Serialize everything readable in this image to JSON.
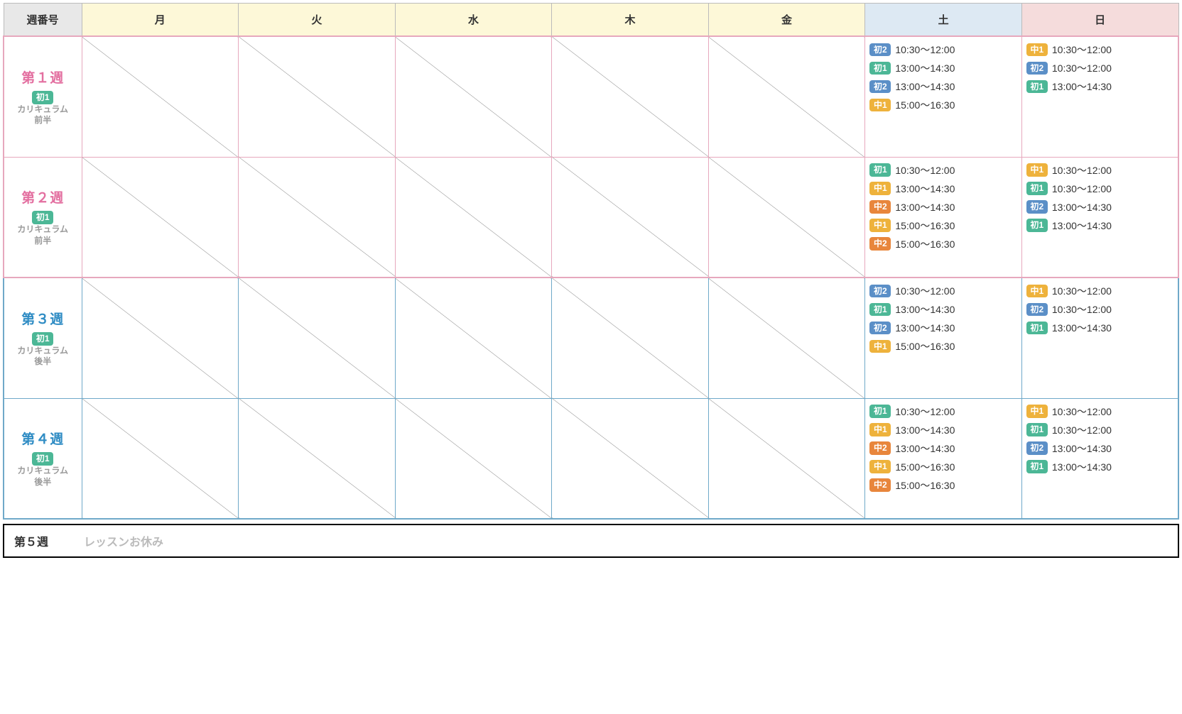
{
  "header": {
    "week_no": "週番号",
    "days": [
      "月",
      "火",
      "水",
      "木",
      "金",
      "土",
      "日"
    ]
  },
  "tags": {
    "s1": "初1",
    "s2": "初2",
    "m1": "中1",
    "m2": "中2"
  },
  "weeks": [
    {
      "id": "w1",
      "group": "pink",
      "title": "第１週",
      "badge": "s1",
      "sub1": "カリキュラム",
      "sub2": "前半",
      "sat": [
        {
          "tag": "s2",
          "time": "10:30～12:00"
        },
        {
          "tag": "s1",
          "time": "13:00～14:30"
        },
        {
          "tag": "s2",
          "time": "13:00～14:30"
        },
        {
          "tag": "m1",
          "time": "15:00～16:30"
        }
      ],
      "sun": [
        {
          "tag": "m1",
          "time": "10:30～12:00"
        },
        {
          "tag": "s2",
          "time": "10:30～12:00"
        },
        {
          "tag": "s1",
          "time": "13:00～14:30"
        }
      ]
    },
    {
      "id": "w2",
      "group": "pink",
      "title": "第２週",
      "badge": "s1",
      "sub1": "カリキュラム",
      "sub2": "前半",
      "sat": [
        {
          "tag": "s1",
          "time": "10:30～12:00"
        },
        {
          "tag": "m1",
          "time": "13:00～14:30"
        },
        {
          "tag": "m2",
          "time": "13:00～14:30"
        },
        {
          "tag": "m1",
          "time": "15:00～16:30"
        },
        {
          "tag": "m2",
          "time": "15:00～16:30"
        }
      ],
      "sun": [
        {
          "tag": "m1",
          "time": "10:30～12:00"
        },
        {
          "tag": "s1",
          "time": "10:30～12:00"
        },
        {
          "tag": "s2",
          "time": "13:00～14:30"
        },
        {
          "tag": "s1",
          "time": "13:00～14:30"
        }
      ]
    },
    {
      "id": "w3",
      "group": "blue",
      "title": "第３週",
      "badge": "s1",
      "sub1": "カリキュラム",
      "sub2": "後半",
      "sat": [
        {
          "tag": "s2",
          "time": "10:30～12:00"
        },
        {
          "tag": "s1",
          "time": "13:00～14:30"
        },
        {
          "tag": "s2",
          "time": "13:00～14:30"
        },
        {
          "tag": "m1",
          "time": "15:00～16:30"
        }
      ],
      "sun": [
        {
          "tag": "m1",
          "time": "10:30～12:00"
        },
        {
          "tag": "s2",
          "time": "10:30～12:00"
        },
        {
          "tag": "s1",
          "time": "13:00～14:30"
        }
      ]
    },
    {
      "id": "w4",
      "group": "blue",
      "title": "第４週",
      "badge": "s1",
      "sub1": "カリキュラム",
      "sub2": "後半",
      "sat": [
        {
          "tag": "s1",
          "time": "10:30～12:00"
        },
        {
          "tag": "m1",
          "time": "13:00～14:30"
        },
        {
          "tag": "m2",
          "time": "13:00～14:30"
        },
        {
          "tag": "m1",
          "time": "15:00～16:30"
        },
        {
          "tag": "m2",
          "time": "15:00～16:30"
        }
      ],
      "sun": [
        {
          "tag": "m1",
          "time": "10:30～12:00"
        },
        {
          "tag": "s1",
          "time": "10:30～12:00"
        },
        {
          "tag": "s2",
          "time": "13:00～14:30"
        },
        {
          "tag": "s1",
          "time": "13:00～14:30"
        }
      ]
    }
  ],
  "week5": {
    "title": "第５週",
    "text": "レッスンお休み"
  }
}
